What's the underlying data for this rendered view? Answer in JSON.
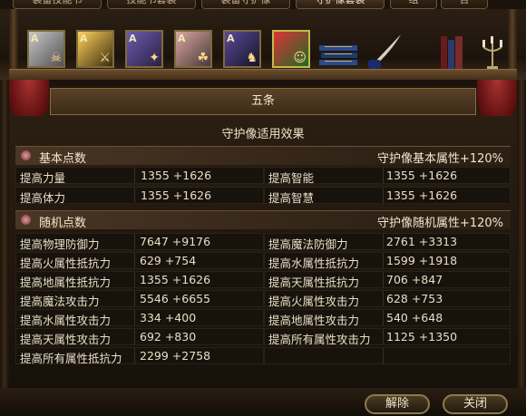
{
  "tabs": [
    "装备技能书",
    "技能书套装",
    "装备守护像",
    "守护像套装",
    "组",
    "合"
  ],
  "cards": [
    {
      "label": "A",
      "icon": "skeleton-knight-card-icon"
    },
    {
      "label": "A",
      "icon": "dark-warrior-card-icon"
    },
    {
      "label": "A",
      "icon": "purple-mage-card-icon"
    },
    {
      "label": "A",
      "icon": "old-sage-card-icon"
    },
    {
      "label": "A",
      "icon": "armored-demon-card-icon"
    },
    {
      "label": "",
      "icon": "clown-jester-card-icon"
    }
  ],
  "title": "五条",
  "subtitle": "守护像适用效果",
  "base_section": {
    "name": "基本点数",
    "bonus": "守护像基本属性+120%",
    "rows": [
      {
        "left_label": "提高力量",
        "left_value": "1355 +1626",
        "right_label": "提高智能",
        "right_value": "1355 +1626"
      },
      {
        "left_label": "提高体力",
        "left_value": "1355 +1626",
        "right_label": "提高智慧",
        "right_value": "1355 +1626"
      }
    ]
  },
  "random_section": {
    "name": "随机点数",
    "bonus": "守护像随机属性+120%",
    "rows": [
      {
        "left_label": "提高物理防御力",
        "left_value": "7647 +9176",
        "right_label": "提高魔法防御力",
        "right_value": "2761 +3313"
      },
      {
        "left_label": "提高火属性抵抗力",
        "left_value": "629 +754",
        "right_label": "提高水属性抵抗力",
        "right_value": "1599 +1918"
      },
      {
        "left_label": "提高地属性抵抗力",
        "left_value": "1355 +1626",
        "right_label": "提高天属性抵抗力",
        "right_value": "706 +847"
      },
      {
        "left_label": "提高魔法攻击力",
        "left_value": "5546 +6655",
        "right_label": "提高火属性攻击力",
        "right_value": "628 +753"
      },
      {
        "left_label": "提高水属性攻击力",
        "left_value": "334 +400",
        "right_label": "提高地属性攻击力",
        "right_value": "540 +648"
      },
      {
        "left_label": "提高天属性攻击力",
        "left_value": "692 +830",
        "right_label": "提高所有属性攻击力",
        "right_value": "1125 +1350"
      },
      {
        "left_label": "提高所有属性抵抗力",
        "left_value": "2299 +2758",
        "right_label": "",
        "right_value": ""
      }
    ]
  },
  "buttons": {
    "release": "解除",
    "close": "关闭"
  },
  "colors": {
    "background": "#0b0907",
    "panel": "#2a1e12",
    "text": "#e8e0cc",
    "accent_gold": "#8c7b4a",
    "curtain_red": "#a33333"
  }
}
